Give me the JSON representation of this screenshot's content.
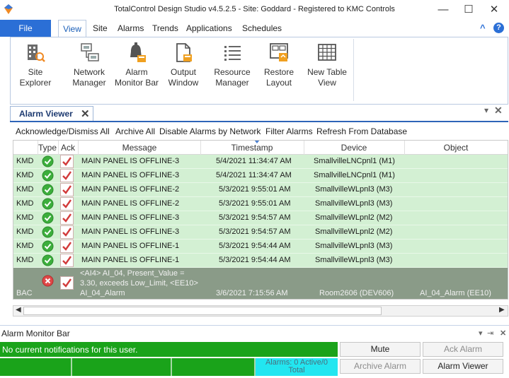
{
  "window": {
    "title": "TotalControl Design Studio  v4.5.2.5 - Site: Goddard - Registered to KMC Controls",
    "minimize_glyph": "—",
    "maximize_glyph": "☐",
    "close_glyph": "✕"
  },
  "ribbon": {
    "tabs": [
      "File",
      "View",
      "Site",
      "Alarms",
      "Trends",
      "Applications",
      "Schedules"
    ],
    "active_tab": "View",
    "collapse_glyph": "^",
    "help_glyph": "?",
    "buttons": [
      {
        "line1": "Site",
        "line2": "Explorer",
        "icon": "site-explorer-icon"
      },
      {
        "line1": "Network",
        "line2": "Manager",
        "icon": "network-manager-icon"
      },
      {
        "line1": "Alarm",
        "line2": "Monitor Bar",
        "icon": "alarm-bell-icon"
      },
      {
        "line1": "Output",
        "line2": "Window",
        "icon": "output-window-icon"
      },
      {
        "line1": "Resource",
        "line2": "Manager",
        "icon": "resource-list-icon"
      },
      {
        "line1": "Restore",
        "line2": "Layout",
        "icon": "restore-layout-icon"
      },
      {
        "line1": "New Table",
        "line2": "View",
        "icon": "table-grid-icon"
      }
    ]
  },
  "alarm_viewer": {
    "tab_label": "Alarm Viewer",
    "close_glyph": "✕",
    "toolbar": [
      "Acknowledge/Dismiss All",
      "Archive All",
      "Disable Alarms by Network",
      "Filter Alarms",
      "Refresh From Database"
    ],
    "columns": [
      "Type",
      "Ack",
      "Message",
      "Timestamp",
      "Device",
      "Object"
    ],
    "rows": [
      {
        "source": "KMD",
        "message": "MAIN PANEL IS OFFLINE-3",
        "timestamp": "5/4/2021 11:34:47 AM",
        "device": "SmallvilleLNCpnl1 (M1)",
        "object": ""
      },
      {
        "source": "KMD",
        "message": "MAIN PANEL IS OFFLINE-3",
        "timestamp": "5/4/2021 11:34:47 AM",
        "device": "SmallvilleLNCpnl1 (M1)",
        "object": ""
      },
      {
        "source": "KMD",
        "message": "MAIN PANEL IS OFFLINE-2",
        "timestamp": "5/3/2021 9:55:01 AM",
        "device": "SmallvilleWLpnl3 (M3)",
        "object": ""
      },
      {
        "source": "KMD",
        "message": "MAIN PANEL IS OFFLINE-2",
        "timestamp": "5/3/2021 9:55:01 AM",
        "device": "SmallvilleWLpnl3 (M3)",
        "object": ""
      },
      {
        "source": "KMD",
        "message": "MAIN PANEL IS OFFLINE-3",
        "timestamp": "5/3/2021 9:54:57 AM",
        "device": "SmallvilleWLpnl2 (M2)",
        "object": ""
      },
      {
        "source": "KMD",
        "message": "MAIN PANEL IS OFFLINE-3",
        "timestamp": "5/3/2021 9:54:57 AM",
        "device": "SmallvilleWLpnl2 (M2)",
        "object": ""
      },
      {
        "source": "KMD",
        "message": "MAIN PANEL IS OFFLINE-1",
        "timestamp": "5/3/2021 9:54:44 AM",
        "device": "SmallvilleWLpnl3 (M3)",
        "object": ""
      },
      {
        "source": "KMD",
        "message": "MAIN PANEL IS OFFLINE-1",
        "timestamp": "5/3/2021 9:54:44 AM",
        "device": "SmallvilleWLpnl3 (M3)",
        "object": ""
      }
    ],
    "selected_row": {
      "source": "BAC",
      "message_line1": "<AI4> AI_04, Present_Value =",
      "message_line2": "3.30, exceeds Low_Limit, <EE10>",
      "message_line3": "AI_04_Alarm",
      "timestamp": "3/6/2021 7:15:56 AM",
      "device": "Room2606 (DEV606)",
      "object": "AI_04_Alarm (EE10)"
    }
  },
  "monitor_bar": {
    "title": "Alarm Monitor Bar",
    "status_text": "No current notifications for this user.",
    "counter_line1": "Alarms: 0 Active/0",
    "counter_line2": "Total",
    "buttons": {
      "mute": "Mute",
      "ack_alarm": "Ack Alarm",
      "archive_alarm": "Archive Alarm",
      "alarm_viewer": "Alarm Viewer"
    }
  },
  "colors": {
    "file_tab": "#2b6fd6",
    "row_green": "#d3f0d3",
    "selected_row": "#8a9b88",
    "status_green": "#1aa31a",
    "counter_cyan": "#22e6f0"
  }
}
